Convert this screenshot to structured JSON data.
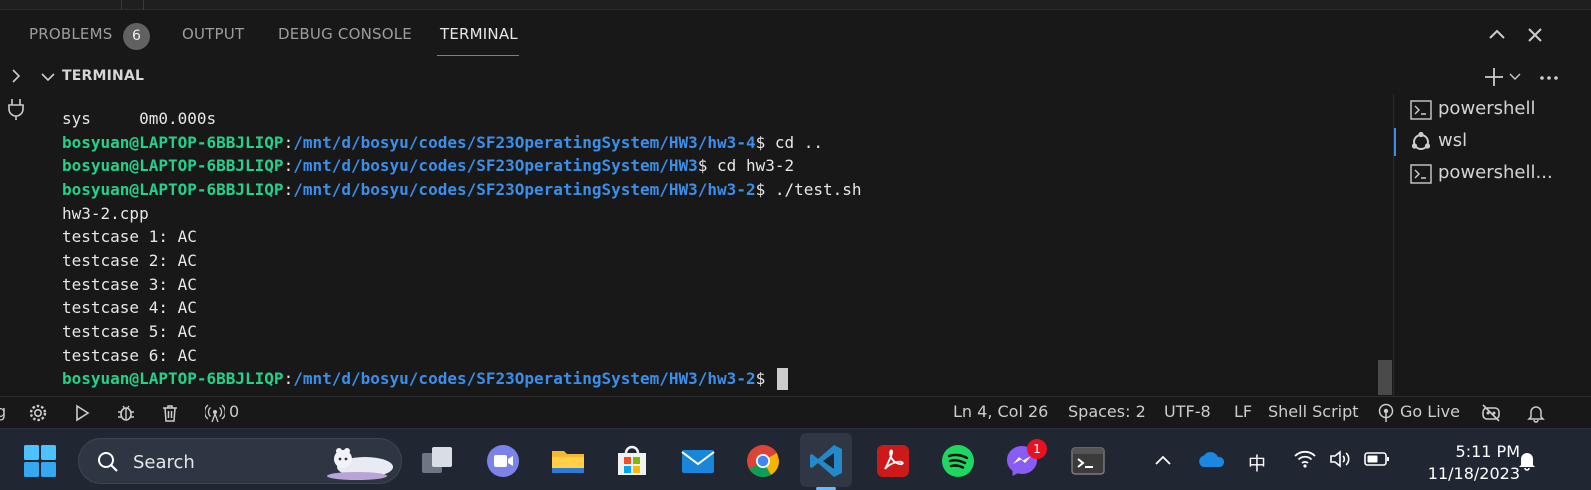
{
  "panel": {
    "tabs": [
      {
        "label": "PROBLEMS",
        "badge": "6"
      },
      {
        "label": "OUTPUT"
      },
      {
        "label": "DEBUG CONSOLE"
      },
      {
        "label": "TERMINAL"
      }
    ]
  },
  "terminal": {
    "title": "TERMINAL",
    "lines": [
      {
        "text": "sys     0m0.000s"
      },
      {
        "user": "bosyuan@LAPTOP-6BBJLIQP",
        "sep": ":",
        "path": "/mnt/d/bosyu/codes/SF23OperatingSystem/HW3/hw3-4",
        "cmd": "$ cd .."
      },
      {
        "user": "bosyuan@LAPTOP-6BBJLIQP",
        "sep": ":",
        "path": "/mnt/d/bosyu/codes/SF23OperatingSystem/HW3",
        "cmd": "$ cd hw3-2"
      },
      {
        "user": "bosyuan@LAPTOP-6BBJLIQP",
        "sep": ":",
        "path": "/mnt/d/bosyu/codes/SF23OperatingSystem/HW3/hw3-2",
        "cmd": "$ ./test.sh"
      },
      {
        "text": "hw3-2.cpp"
      },
      {
        "text": "testcase 1: AC"
      },
      {
        "text": "testcase 2: AC"
      },
      {
        "text": "testcase 3: AC"
      },
      {
        "text": "testcase 4: AC"
      },
      {
        "text": "testcase 5: AC"
      },
      {
        "text": "testcase 6: AC"
      },
      {
        "user": "bosyuan@LAPTOP-6BBJLIQP",
        "sep": ":",
        "path": "/mnt/d/bosyu/codes/SF23OperatingSystem/HW3/hw3-2",
        "cmd": "$ "
      }
    ],
    "sessions": [
      {
        "label": "powershell",
        "icon": "terminal-icon"
      },
      {
        "label": "wsl",
        "icon": "linux-icon"
      },
      {
        "label": "powershell...",
        "icon": "terminal-icon"
      }
    ]
  },
  "statusbar": {
    "ports": "0",
    "position": "Ln 4, Col 26",
    "spaces": "Spaces: 2",
    "encoding": "UTF-8",
    "eol": "LF",
    "language": "Shell Script",
    "golive": "Go Live"
  },
  "taskbar": {
    "search_label": "Search",
    "messenger_badge": "1",
    "ime": "中",
    "time": "5:11 PM",
    "date": "11/18/2023"
  },
  "colors": {
    "prompt_user": "#23d18b",
    "prompt_path": "#3b8eea",
    "accent": "#3b8eea"
  }
}
